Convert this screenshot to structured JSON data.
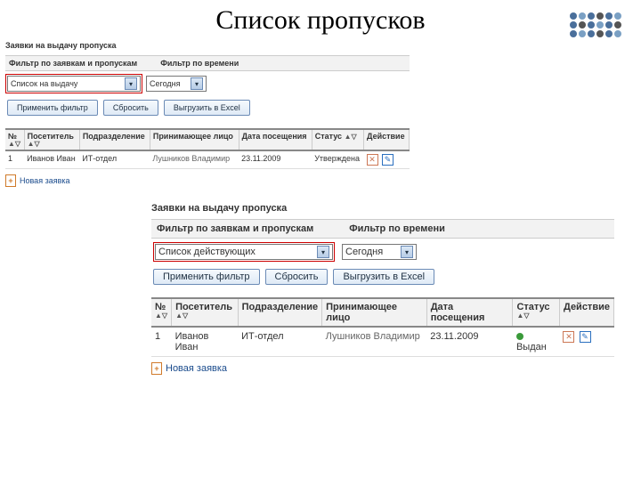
{
  "page": {
    "title": "Список пропусков"
  },
  "panel1": {
    "heading": "Заявки на выдачу пропуска",
    "filter_caption1": "Фильтр по заявкам и пропускам",
    "filter_caption2": "Фильтр по времени",
    "select_main": "Список на выдачу",
    "select_time": "Сегодня",
    "btn_apply": "Применить фильтр",
    "btn_reset": "Сбросить",
    "btn_export": "Выгрузить в Excel",
    "cols": {
      "num": "№",
      "visitor": "Посетитель",
      "dept": "Подразделение",
      "host": "Принимающее лицо",
      "date": "Дата посещения",
      "status": "Статус",
      "action": "Действие"
    },
    "row": {
      "num": "1",
      "visitor": "Иванов Иван",
      "dept": "ИТ-отдел",
      "host": "Лушников Владимир",
      "date": "23.11.2009",
      "status": "Утверждена"
    },
    "link_new": "Новая заявка"
  },
  "panel2": {
    "heading": "Заявки на выдачу пропуска",
    "filter_caption1": "Фильтр по заявкам и пропускам",
    "filter_caption2": "Фильтр по времени",
    "select_main": "Список действующих",
    "select_time": "Сегодня",
    "btn_apply": "Применить фильтр",
    "btn_reset": "Сбросить",
    "btn_export": "Выгрузить в Excel",
    "cols": {
      "num": "№",
      "visitor": "Посетитель",
      "dept": "Подразделение",
      "host": "Принимающее лицо",
      "date": "Дата посещения",
      "status": "Статус",
      "action": "Действие"
    },
    "row": {
      "num": "1",
      "visitor": "Иванов Иван",
      "dept": "ИТ-отдел",
      "host": "Лушников Владимир",
      "date": "23.11.2009",
      "status": "Выдан"
    },
    "link_new": "Новая заявка"
  }
}
